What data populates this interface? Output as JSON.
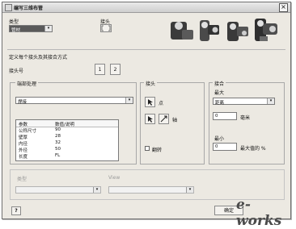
{
  "window": {
    "title": "编写三维布管",
    "close_glyph": "×"
  },
  "top": {
    "type_label": "类型",
    "type_value": "管材",
    "joint_label": "接头"
  },
  "section": {
    "specify_label": "定义每个接头及其接合方式",
    "joint_no_label": "接头号",
    "joint_1": "1",
    "joint_2": "2"
  },
  "end_treatment": {
    "title": "端部处理",
    "value": "焊接",
    "columns": [
      "参数",
      "数值/说明"
    ],
    "rows": [
      [
        "公称尺寸",
        "90"
      ],
      [
        "壁厚",
        "28"
      ],
      [
        "内径",
        "32"
      ],
      [
        "外径",
        "50"
      ],
      [
        "长度",
        "FL"
      ]
    ]
  },
  "joint_group": {
    "title": "接头",
    "point_label": "点",
    "axis_label": "轴",
    "flip_label": "翻转"
  },
  "gap_group": {
    "title": "接合",
    "max_label": "最大",
    "type_value": "距离",
    "max_value": "0",
    "max_unit": "毫米",
    "min_label": "最小",
    "min_value": "0",
    "min_unit": "最大值的 %"
  },
  "lower": {
    "left_label": "类型",
    "right_label": "View"
  },
  "footer": {
    "ok_label": "确定",
    "help_glyph": "?"
  },
  "watermark": "e-works"
}
